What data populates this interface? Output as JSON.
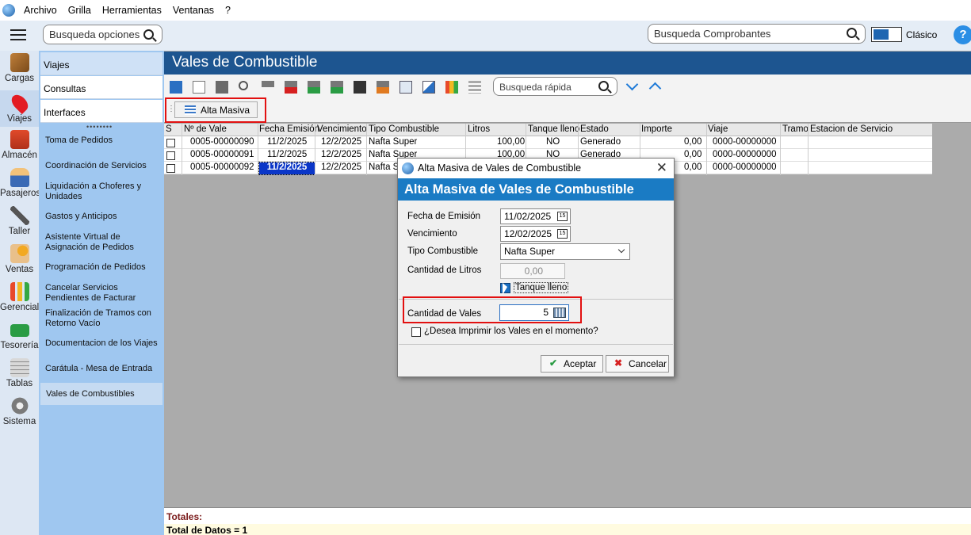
{
  "menubar": {
    "items": [
      "Archivo",
      "Grilla",
      "Herramientas",
      "Ventanas",
      "?"
    ]
  },
  "topbar": {
    "search_options_placeholder": "Busqueda opciones",
    "search_comprobantes_placeholder": "Busqueda Comprobantes",
    "mode_label": "Clásico",
    "help": "?"
  },
  "leftbar": {
    "items": [
      {
        "label": "Cargas",
        "icon": "truck-icon"
      },
      {
        "label": "Viajes",
        "icon": "map-pin-icon"
      },
      {
        "label": "Almacén",
        "icon": "warehouse-icon"
      },
      {
        "label": "Pasajeros",
        "icon": "passenger-icon"
      },
      {
        "label": "Taller",
        "icon": "wrench-icon"
      },
      {
        "label": "Ventas",
        "icon": "sales-icon"
      },
      {
        "label": "Gerencial",
        "icon": "chart-icon"
      },
      {
        "label": "Tesorería",
        "icon": "money-icon"
      },
      {
        "label": "Tablas",
        "icon": "table-icon"
      },
      {
        "label": "Sistema",
        "icon": "gear-icon"
      }
    ]
  },
  "submenu": {
    "tabs": [
      "Viajes",
      "Consultas",
      "Interfaces"
    ],
    "items": [
      "Toma de Pedidos",
      "Coordinación de Servicios",
      "Liquidación a Choferes y Unidades",
      "Gastos y Anticipos",
      "Asistente Virtual de Asignación de Pedidos",
      "Programación de Pedidos",
      "Cancelar Servicios Pendientes de Facturar",
      "Finalización de Tramos con Retorno Vacío",
      "Documentacion de los Viajes",
      "Carátula - Mesa de Entrada",
      "Vales de Combustibles"
    ]
  },
  "main": {
    "title": "Vales de Combustible",
    "quick_search_placeholder": "Busqueda rápida",
    "alta_masiva_label": "Alta Masiva"
  },
  "grid": {
    "headers": [
      "S",
      "Nº de Vale",
      "Fecha Emisión",
      "Vencimiento",
      "Tipo Combustible",
      "Litros",
      "Tanque lleno",
      "Estado",
      "Importe",
      "Viaje",
      "Tramo",
      "Estacion de Servicio"
    ],
    "rows": [
      {
        "vale": "0005-00000090",
        "emision": "11/2/2025",
        "venc": "12/2/2025",
        "tipo": "Nafta Super",
        "litros": "100,00",
        "tanque": "NO",
        "estado": "Generado",
        "importe": "0,00",
        "viaje": "0000-00000000"
      },
      {
        "vale": "0005-00000091",
        "emision": "11/2/2025",
        "venc": "12/2/2025",
        "tipo": "Nafta Super",
        "litros": "100,00",
        "tanque": "NO",
        "estado": "Generado",
        "importe": "0,00",
        "viaje": "0000-00000000"
      },
      {
        "vale": "0005-00000092",
        "emision": "11/2/2025",
        "venc": "12/2/2025",
        "tipo": "Nafta Su",
        "litros": "",
        "tanque": "",
        "estado": "",
        "importe": "0,00",
        "viaje": "0000-00000000"
      }
    ]
  },
  "totals": {
    "label": "Totales:",
    "count": "Total de Datos = 1"
  },
  "dialog": {
    "window_title": "Alta Masiva de Vales de Combustible",
    "header": "Alta Masiva de Vales de Combustible",
    "fecha_emision_label": "Fecha de Emisión",
    "fecha_emision_value": "11/02/2025",
    "vencimiento_label": "Vencimiento",
    "vencimiento_value": "12/02/2025",
    "tipo_label": "Tipo Combustible",
    "tipo_value": "Nafta Super",
    "litros_label": "Cantidad de Litros",
    "litros_value": "0,00",
    "tanque_label": "Tanque lleno",
    "cantidad_label": "Cantidad de Vales",
    "cantidad_value": "5",
    "imprimir_label": "¿Desea Imprimir los Vales en el momento?",
    "aceptar": "Aceptar",
    "cancelar": "Cancelar"
  },
  "colors": {
    "header_blue": "#1d5590",
    "dialog_header": "#1a7bc4",
    "highlight_red": "#e21010"
  }
}
